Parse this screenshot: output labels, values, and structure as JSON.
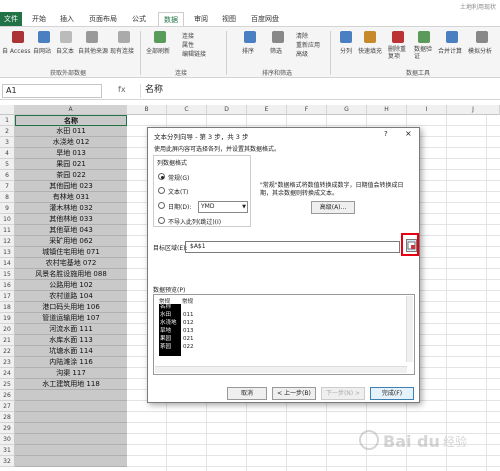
{
  "window": {
    "title": "土地利用现状"
  },
  "tabs": [
    {
      "label": "文件"
    },
    {
      "label": "开始"
    },
    {
      "label": "插入"
    },
    {
      "label": "页面布局"
    },
    {
      "label": "公式"
    },
    {
      "label": "数据"
    },
    {
      "label": "审阅"
    },
    {
      "label": "视图"
    },
    {
      "label": "百度网盘"
    }
  ],
  "ribbon": {
    "get_data": {
      "items": [
        "自 Access",
        "自网站",
        "自文本",
        "自其他来源",
        "现有连接"
      ],
      "group": "获取外部数据"
    },
    "connections": {
      "refresh": "全部刷新",
      "items": [
        "连接",
        "属性",
        "编辑链接"
      ],
      "group": "连接"
    },
    "sort_filter": {
      "items": [
        "排序",
        "筛选",
        "清除",
        "重新应用",
        "高级"
      ],
      "group": "排序和筛选"
    },
    "data_tools": {
      "items": [
        "分列",
        "快速填充",
        "删除重复项",
        "数据验证",
        "合并计算",
        "模拟分析"
      ],
      "group": "数据工具"
    }
  },
  "formula_bar": {
    "name_box": "A1",
    "fx": "fx",
    "content": "名称"
  },
  "columns": [
    "A",
    "B",
    "C",
    "D",
    "E",
    "F",
    "G",
    "H",
    "I",
    "J"
  ],
  "rows": {
    "numbers": [
      "1",
      "2",
      "3",
      "4",
      "5",
      "6",
      "7",
      "8",
      "9",
      "10",
      "11",
      "12",
      "13",
      "14",
      "15",
      "16",
      "17",
      "18",
      "19",
      "20",
      "21",
      "22",
      "23",
      "24",
      "25",
      "26",
      "27",
      "28",
      "29",
      "30",
      "31",
      "32",
      "33"
    ],
    "col_a": [
      "名称",
      "水田 011",
      "水浇地 012",
      "旱地 013",
      "果园 021",
      "茶园 022",
      "其他园地 023",
      "有林地 031",
      "灌木林地 032",
      "其他林地 033",
      "其他草地 043",
      "采矿用地 062",
      "城镇住宅用地 071",
      "农村宅基地 072",
      "风景名胜设施用地 088",
      "公路用地 102",
      "农村道路 104",
      "港口码头用地 106",
      "管道运输用地 107",
      "河流水面 111",
      "水库水面 113",
      "坑塘水面 114",
      "内陆滩涂 116",
      "沟渠 117",
      "水工建筑用地 118",
      "",
      "",
      "",
      "",
      "",
      "",
      "",
      ""
    ]
  },
  "dialog": {
    "title": "文本分列向导 - 第 3 步，共 3 步",
    "help": "?",
    "close": "×",
    "description": "使用此屏内容可选择各列，并设置其数据格式。",
    "format_group": "列数据格式",
    "options": [
      "常规(G)",
      "文本(T)",
      "日期(D):",
      "不导入此列(跳过)(I)"
    ],
    "date_value": "YMD",
    "info_line1": "\"常规\"数据格式将数值转换成数字，日期值会转换成日",
    "info_line2": "期，其余数据则转换成文本。",
    "advanced": "高级(A)...",
    "destination_label": "目标区域(E):",
    "destination_value": "$A$1",
    "preview_label": "数据预览(P)",
    "preview_header": [
      "常规",
      "常规"
    ],
    "preview_col1": [
      "名称",
      "水田",
      "水浇地",
      "旱地",
      "果园",
      "茶园"
    ],
    "preview_col2": [
      "",
      "011",
      "012",
      "013",
      "021",
      "022"
    ],
    "buttons": {
      "cancel": "取消",
      "back": "< 上一步(B)",
      "next": "下一步(N) >",
      "finish": "完成(F)"
    }
  },
  "watermark": {
    "text": "Baidu 经验"
  }
}
